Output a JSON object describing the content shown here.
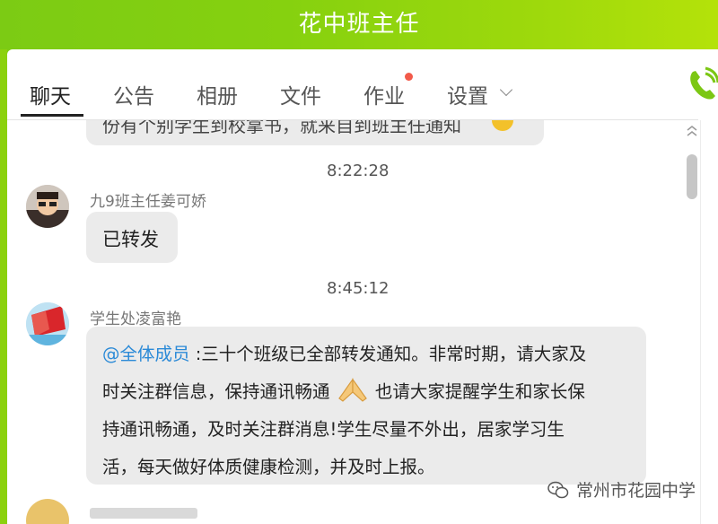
{
  "window": {
    "title": "花中班主任"
  },
  "tabs": [
    {
      "label": "聊天"
    },
    {
      "label": "公告"
    },
    {
      "label": "相册"
    },
    {
      "label": "文件"
    },
    {
      "label": "作业"
    },
    {
      "label": "设置"
    }
  ],
  "messages": {
    "top_partial": {
      "text": "份有个别学生到校拿书，就来自到班主任通知"
    },
    "time1": "8:22:28",
    "msg1": {
      "sender": "九9班主任姜可娇",
      "text": "已转发"
    },
    "time2": "8:45:12",
    "msg2": {
      "sender": "学生处凌富艳",
      "mention": "@全体成员",
      "line1": " :三十个班级已全部转发通知。非常时期，请大家及",
      "line2a": "时关注群信息，保持通讯畅通",
      "line2b": "也请大家提醒学生和家长保",
      "line3": "持通讯畅通，及时关注群消息!学生尽量不外出，居家学习生",
      "line4": "活，每天做好体质健康检测，并及时上报。"
    }
  },
  "watermark": {
    "text": "常州市花园中学"
  },
  "colors": {
    "accent": "#86d10f",
    "mention": "#2b8ad7",
    "bubble": "#ebebeb",
    "badge": "#f25a4a"
  }
}
